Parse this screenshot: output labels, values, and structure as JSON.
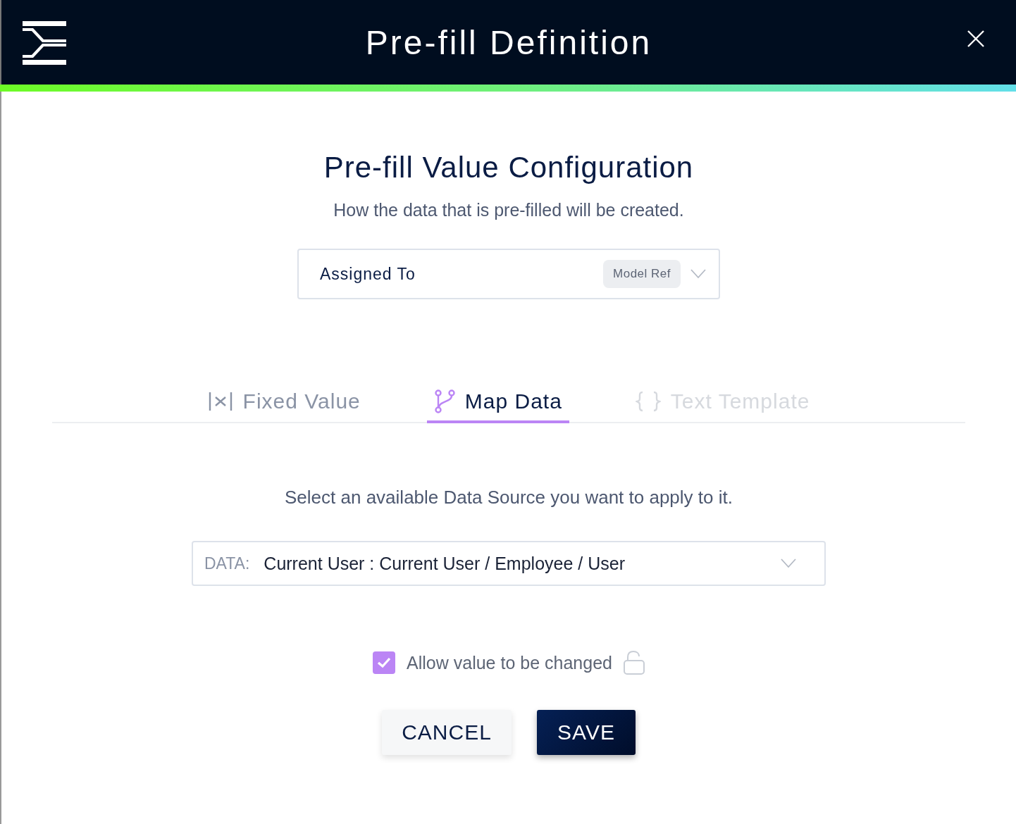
{
  "window": {
    "title": "Pre-fill Definition"
  },
  "heading": "Pre-fill Value Configuration",
  "subtitle": "How the data that is pre-filled will be created.",
  "field_select": {
    "value": "Assigned To",
    "badge": "Model Ref"
  },
  "tabs": [
    {
      "kind": "fixed",
      "label": "Fixed Value",
      "selected": false,
      "disabled": false
    },
    {
      "kind": "map",
      "label": "Map Data",
      "selected": true,
      "disabled": false
    },
    {
      "kind": "template",
      "label": "Text Template",
      "selected": false,
      "disabled": true
    }
  ],
  "instruction": "Select an available Data Source you want to apply to it.",
  "data_select": {
    "prefix": "DATA:",
    "value": "Current User : Current User / Employee / User"
  },
  "allow_change": {
    "label": "Allow value to be changed",
    "checked": true
  },
  "buttons": [
    {
      "kind": "secondary",
      "label": "CANCEL"
    },
    {
      "kind": "primary",
      "label": "SAVE"
    }
  ]
}
